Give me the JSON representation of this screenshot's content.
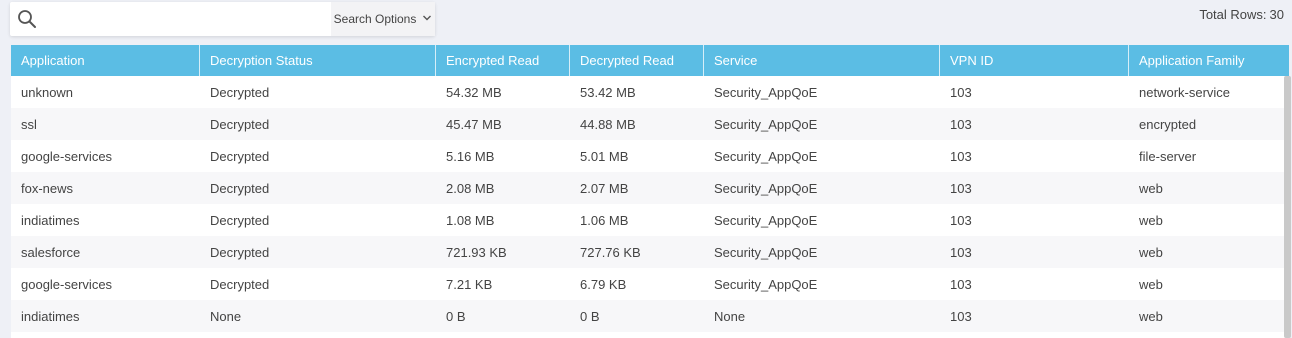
{
  "search": {
    "placeholder": "",
    "value": "",
    "options_label": "Search Options"
  },
  "summary": {
    "total_rows_label": "Total Rows:",
    "total_rows_value": "30"
  },
  "table": {
    "columns": [
      "Application",
      "Decryption Status",
      "Encrypted Read",
      "Decrypted Read",
      "Service",
      "VPN ID",
      "Application Family"
    ],
    "rows": [
      [
        "unknown",
        "Decrypted",
        "54.32 MB",
        "53.42 MB",
        "Security_AppQoE",
        "103",
        "network-service"
      ],
      [
        "ssl",
        "Decrypted",
        "45.47 MB",
        "44.88 MB",
        "Security_AppQoE",
        "103",
        "encrypted"
      ],
      [
        "google-services",
        "Decrypted",
        "5.16 MB",
        "5.01 MB",
        "Security_AppQoE",
        "103",
        "file-server"
      ],
      [
        "fox-news",
        "Decrypted",
        "2.08 MB",
        "2.07 MB",
        "Security_AppQoE",
        "103",
        "web"
      ],
      [
        "indiatimes",
        "Decrypted",
        "1.08 MB",
        "1.06 MB",
        "Security_AppQoE",
        "103",
        "web"
      ],
      [
        "salesforce",
        "Decrypted",
        "721.93 KB",
        "727.76 KB",
        "Security_AppQoE",
        "103",
        "web"
      ],
      [
        "google-services",
        "Decrypted",
        "7.21 KB",
        "6.79 KB",
        "Security_AppQoE",
        "103",
        "web"
      ],
      [
        "indiatimes",
        "None",
        "0 B",
        "0 B",
        "None",
        "103",
        "web"
      ]
    ]
  },
  "icons": {
    "search": "search-icon",
    "dropdown": "chevron-down-icon"
  },
  "colors": {
    "header_bg": "#5bbde4",
    "header_text": "#ffffff",
    "page_bg": "#eef0f6"
  }
}
